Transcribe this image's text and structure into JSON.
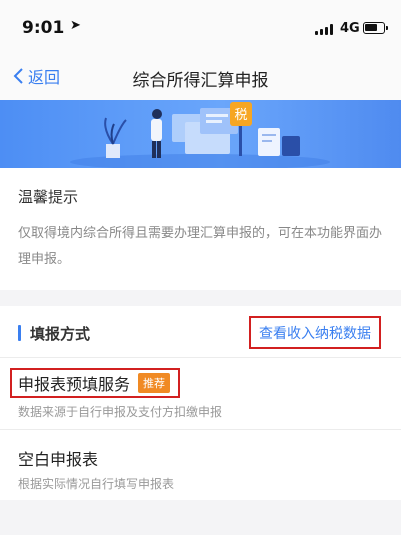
{
  "status": {
    "time": "9:01",
    "network": "4G"
  },
  "nav": {
    "back_label": "返回",
    "title": "综合所得汇算申报"
  },
  "banner": {
    "sign_text": "税"
  },
  "tips": {
    "title": "温馨提示",
    "body": "仅取得境内综合所得且需要办理汇算申报的，可在本功能界面办理申报。"
  },
  "section": {
    "title": "填报方式",
    "link": "查看收入纳税数据"
  },
  "options": [
    {
      "title": "申报表预填服务",
      "badge": "推荐",
      "desc": "数据来源于自行申报及支付方扣缴申报"
    },
    {
      "title": "空白申报表",
      "desc": "根据实际情况自行填写申报表"
    }
  ],
  "colors": {
    "accent": "#3a7ff0",
    "highlight_border": "#d22020",
    "badge": "#f08a24",
    "banner": "#5a98f6"
  }
}
